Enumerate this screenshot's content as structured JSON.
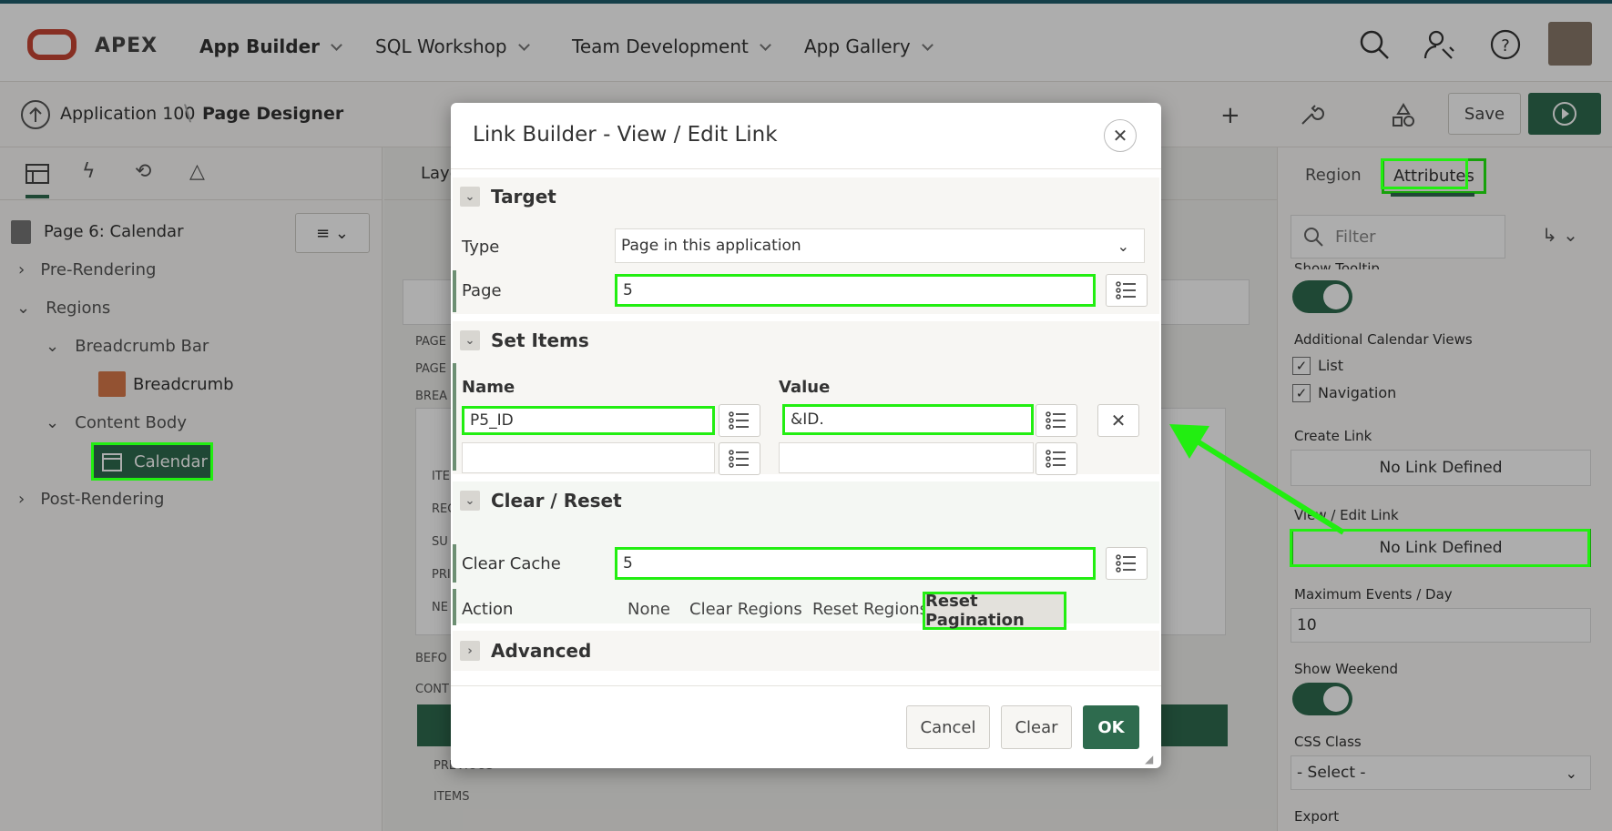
{
  "header": {
    "brand": "APEX",
    "nav": [
      {
        "label": "App Builder"
      },
      {
        "label": "SQL Workshop"
      },
      {
        "label": "Team Development"
      },
      {
        "label": "App Gallery"
      }
    ]
  },
  "toolbar": {
    "breadcrumb_app": "Application 100",
    "breadcrumb_sep": "\\",
    "breadcrumb_page": "Page Designer",
    "save_label": "Save"
  },
  "left": {
    "page_title": "Page 6: Calendar",
    "tree": {
      "pre_rendering": "Pre-Rendering",
      "regions": "Regions",
      "breadcrumb_bar": "Breadcrumb Bar",
      "breadcrumb": "Breadcrumb",
      "content_body": "Content Body",
      "calendar": "Calendar",
      "post_rendering": "Post-Rendering"
    }
  },
  "middle": {
    "tab": "Layo",
    "labels": [
      "PAGE",
      "PAGE",
      "BREA",
      "ITE",
      "REG",
      "SU",
      "PRI",
      "NE",
      "BEFO",
      "CONT",
      "PREVIOUS",
      "ITEMS"
    ]
  },
  "right": {
    "tab_region": "Region",
    "tab_attributes": "Attributes",
    "filter_placeholder": "Filter",
    "show_tooltip": "Show Tooltip",
    "additional_views": "Additional Calendar Views",
    "list": "List",
    "navigation": "Navigation",
    "create_link": "Create Link",
    "create_link_value": "No Link Defined",
    "view_edit_link": "View / Edit Link",
    "view_edit_link_value": "No Link Defined",
    "max_events": "Maximum Events / Day",
    "max_events_value": "10",
    "show_weekend": "Show Weekend",
    "css_class": "CSS Class",
    "css_class_value": "- Select -",
    "export": "Export"
  },
  "dialog": {
    "title": "Link Builder - View / Edit Link",
    "target": {
      "heading": "Target",
      "type_label": "Type",
      "type_value": "Page in this application",
      "page_label": "Page",
      "page_value": "5"
    },
    "set_items": {
      "heading": "Set Items",
      "name_header": "Name",
      "value_header": "Value",
      "rows": [
        {
          "name": "P5_ID",
          "value": "&ID."
        },
        {
          "name": "",
          "value": ""
        }
      ]
    },
    "clear_reset": {
      "heading": "Clear / Reset",
      "clear_cache_label": "Clear Cache",
      "clear_cache_value": "5",
      "action_label": "Action",
      "actions": [
        "None",
        "Clear Regions",
        "Reset Regions",
        "Reset Pagination"
      ],
      "selected_action": "Reset Pagination"
    },
    "advanced": {
      "heading": "Advanced"
    },
    "buttons": {
      "cancel": "Cancel",
      "clear": "Clear",
      "ok": "OK"
    }
  },
  "colors": {
    "highlight": "#22ee11",
    "primary": "#2e6b4e",
    "accent_strip": "#1f5e6c",
    "brand_red": "#c74634"
  }
}
